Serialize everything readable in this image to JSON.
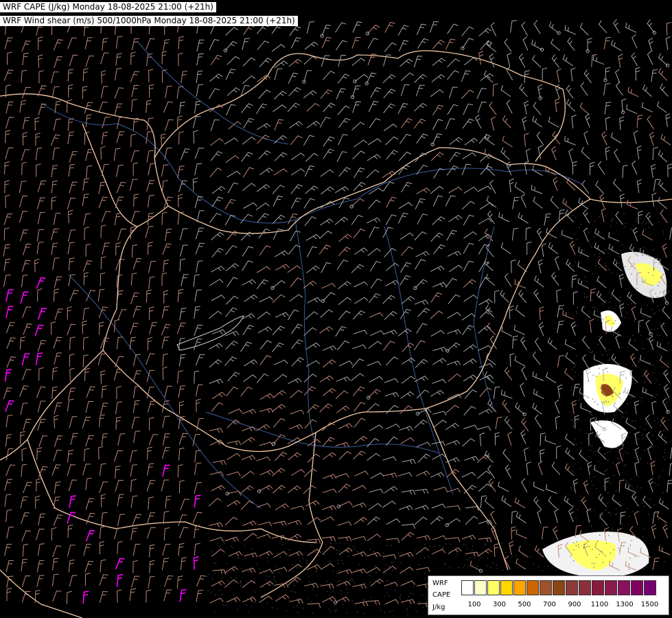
{
  "header": {
    "line1": "WRF CAPE (J/kg) Monday 18-08-2025 21:00 (+21h)",
    "line2": "WRF Wind shear (m/s) 500/1000hPa Monday 18-08-2025 21:00 (+21h)"
  },
  "legend": {
    "title_line1": "WRF",
    "title_line2": "CAPE",
    "unit": "J/kg",
    "colors": [
      "#ffffff",
      "#ffffcc",
      "#ffff66",
      "#ffd700",
      "#ffa500",
      "#cd6600",
      "#a0522d",
      "#8b4513",
      "#8b3a3a",
      "#8b2f3c",
      "#8b1a3c",
      "#8b1a4c",
      "#8b1060",
      "#800060",
      "#760070"
    ],
    "tick_labels": [
      "100",
      "300",
      "500",
      "700",
      "900",
      "1100",
      "1300",
      "1500"
    ]
  },
  "colors": {
    "background": "#000000",
    "border": "#f5cba7",
    "river": "#3a5f9e",
    "barb_low": "#a8a8a8",
    "barb_mid": "#c08878",
    "barb_high": "#e04080",
    "barb_extreme": "#ff00ff",
    "cape_shade": "#ffff66"
  }
}
